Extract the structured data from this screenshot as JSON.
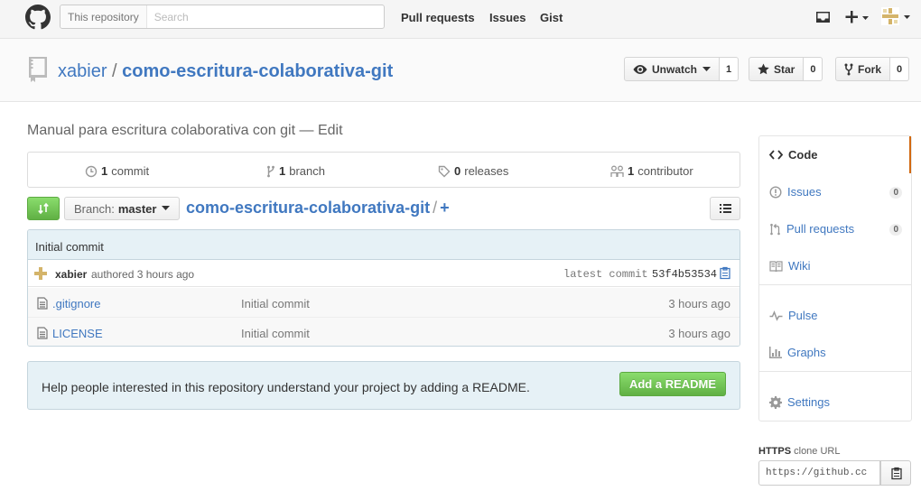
{
  "header": {
    "search_scope": "This repository",
    "search_placeholder": "Search",
    "nav": [
      "Pull requests",
      "Issues",
      "Gist"
    ]
  },
  "repo": {
    "owner": "xabier",
    "separator": "/",
    "name": "como-escritura-colaborativa-git",
    "watch_label": "Unwatch",
    "watch_count": "1",
    "star_label": "Star",
    "star_count": "0",
    "fork_label": "Fork",
    "fork_count": "0"
  },
  "description": {
    "text": "Manual para escritura colaborativa con git",
    "dash": "—",
    "edit": "Edit"
  },
  "summary": {
    "commits_count": "1",
    "commits_label": "commit",
    "branches_count": "1",
    "branches_label": "branch",
    "releases_count": "0",
    "releases_label": "releases",
    "contributors_count": "1",
    "contributors_label": "contributor"
  },
  "filenav": {
    "branch_prefix": "Branch:",
    "branch_name": "master",
    "breadcrumb_repo": "como-escritura-colaborativa-git",
    "breadcrumb_sep": "/",
    "add_symbol": "+"
  },
  "commit": {
    "message": "Initial commit",
    "author": "xabier",
    "authored": "authored 3 hours ago",
    "latest_label": "latest commit",
    "sha": "53f4b53534"
  },
  "files": [
    {
      "name": ".gitignore",
      "message": "Initial commit",
      "age": "3 hours ago"
    },
    {
      "name": "LICENSE",
      "message": "Initial commit",
      "age": "3 hours ago"
    }
  ],
  "readme_banner": {
    "text": "Help people interested in this repository understand your project by adding a README.",
    "button": "Add a README"
  },
  "sidebar": {
    "items": [
      {
        "label": "Code"
      },
      {
        "label": "Issues",
        "count": "0"
      },
      {
        "label": "Pull requests",
        "count": "0"
      },
      {
        "label": "Wiki"
      },
      {
        "label": "Pulse"
      },
      {
        "label": "Graphs"
      },
      {
        "label": "Settings"
      }
    ],
    "clone_protocol": "HTTPS",
    "clone_label": "clone URL",
    "clone_url": "https://github.cc"
  },
  "colors": {
    "link": "#4078c0",
    "green": "#60b044",
    "active_tab": "#d26911",
    "commit_bg": "#e6f1f6"
  }
}
